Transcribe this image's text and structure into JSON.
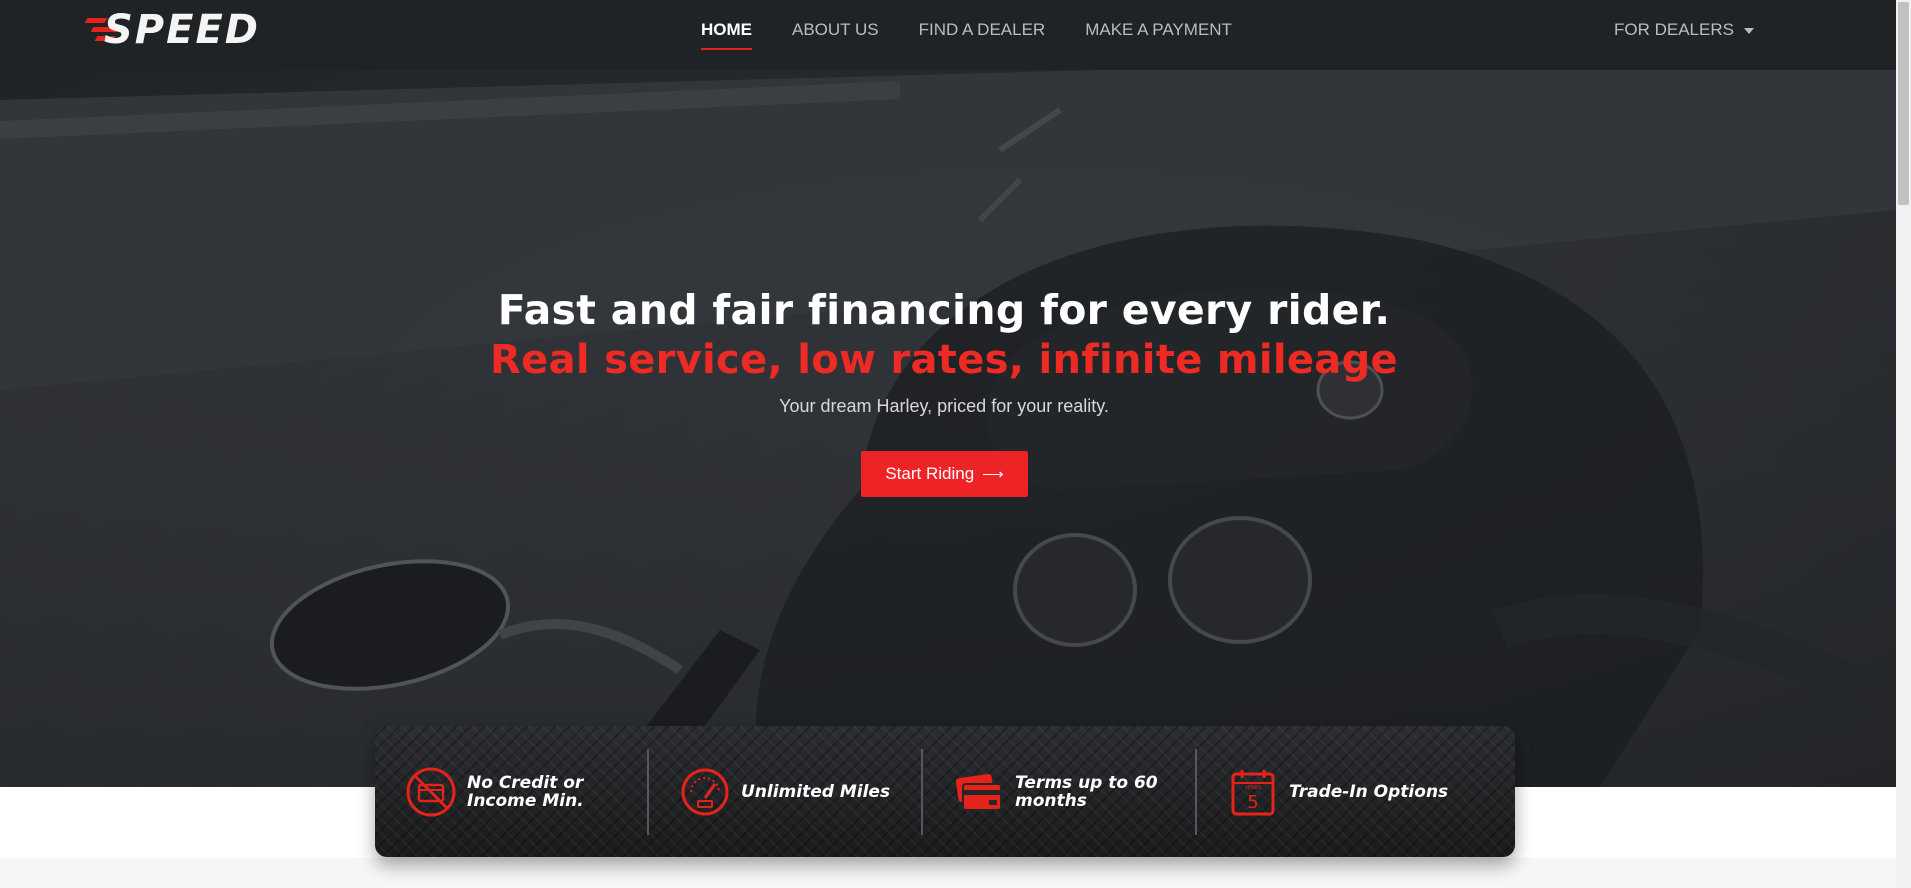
{
  "brand": {
    "logo_text": "SPEED",
    "accent": "#ee2326"
  },
  "nav": {
    "items": [
      {
        "label": "HOME",
        "active": true
      },
      {
        "label": "ABOUT US",
        "active": false
      },
      {
        "label": "FIND A DEALER",
        "active": false
      },
      {
        "label": "MAKE A PAYMENT",
        "active": false
      }
    ],
    "dealers_label": "FOR DEALERS"
  },
  "hero": {
    "headline": "Fast and fair financing for every rider.",
    "subheadline": "Real service, low rates, infinite mileage",
    "tagline": "Your dream Harley, priced for your reality.",
    "cta_label": "Start Riding",
    "cta_icon": "arrow-right-icon"
  },
  "features": [
    {
      "icon": "no-credit-icon",
      "label": "No Credit or Income Min."
    },
    {
      "icon": "speedometer-icon",
      "label": "Unlimited Miles"
    },
    {
      "icon": "credit-card-icon",
      "label": "Terms up to 60 months"
    },
    {
      "icon": "calendar-years-icon",
      "label": "Trade-In Options",
      "calendar_number": "5",
      "calendar_caption": "YEARS"
    }
  ],
  "colors": {
    "nav_bg": "#1f2326",
    "hero_overlay": "#2e3135",
    "features_bg": "#242628",
    "red": "#ee2326"
  }
}
